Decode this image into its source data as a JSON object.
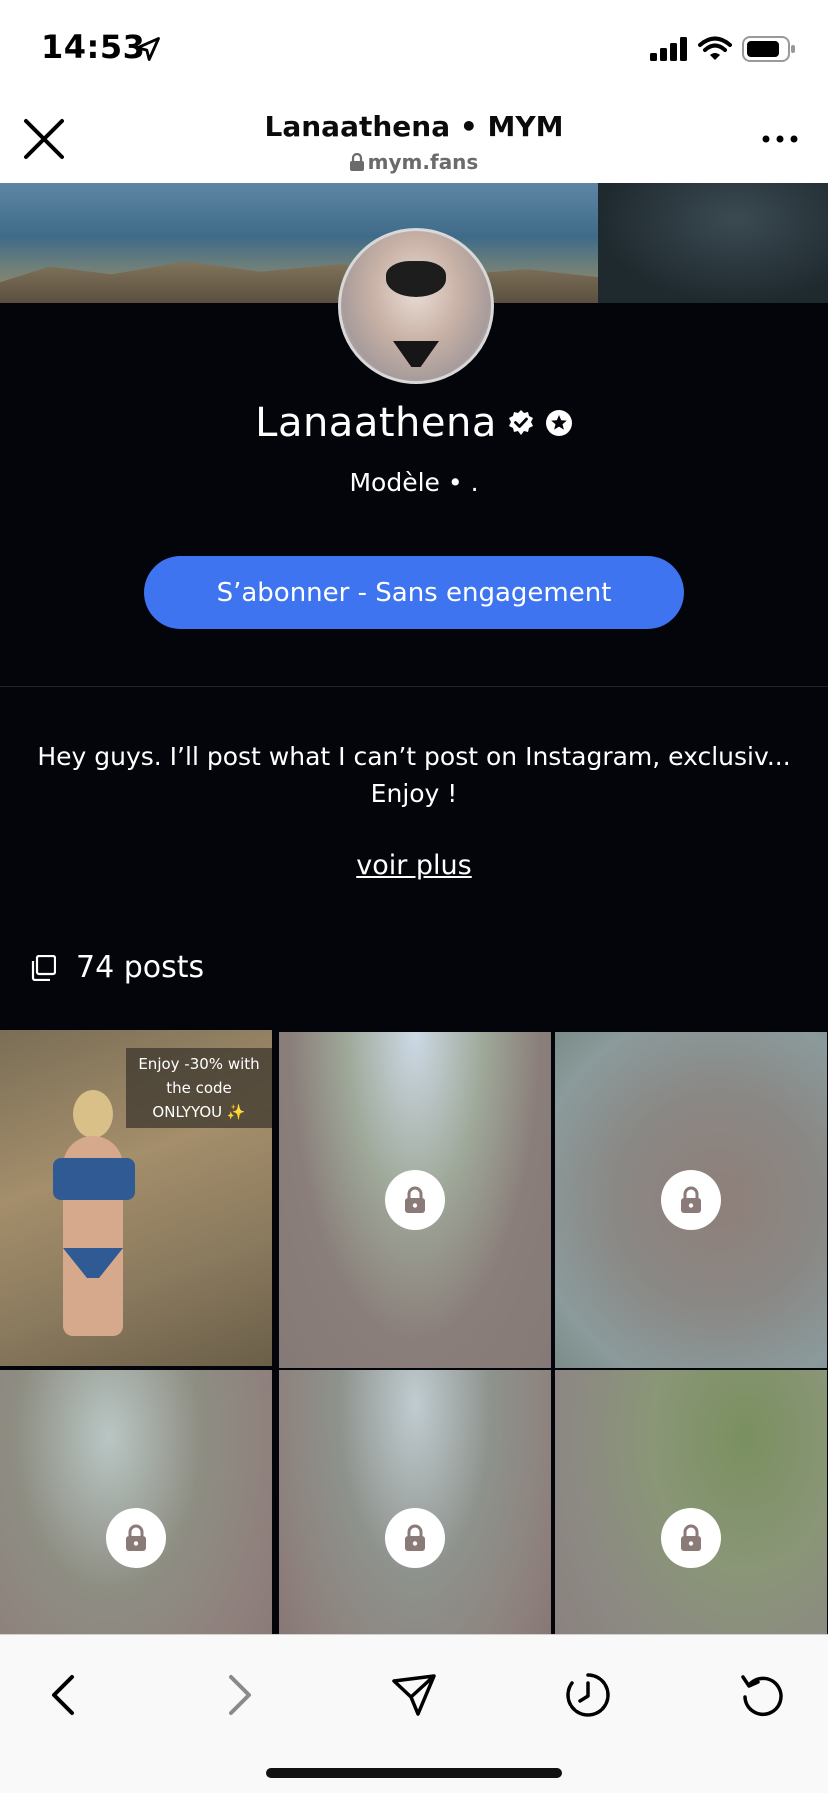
{
  "status_bar": {
    "time": "14:53"
  },
  "browser": {
    "title": "Lanaathena • MYM",
    "url": "mym.fans"
  },
  "profile": {
    "name": "Lanaathena",
    "subtitle": "Modèle • .",
    "subscribe_label": "S’abonner - Sans engagement",
    "bio_line1": "Hey guys. I’ll post what I can’t post on Instagram, exclusiv...",
    "bio_line2": "Enjoy !",
    "see_more": "voir plus",
    "posts_count": "74 posts"
  },
  "grid": {
    "first_post_caption": "Enjoy -30% with the code ONLYYOU ✨",
    "locked_count": 5
  },
  "colors": {
    "accent": "#3f74f0",
    "background": "#03050b"
  },
  "icons": [
    "close-icon",
    "lock-icon",
    "more-icon",
    "verified-badge-icon",
    "star-badge-icon",
    "posts-icon",
    "back-icon",
    "forward-icon",
    "share-icon",
    "history-icon",
    "reload-icon"
  ]
}
